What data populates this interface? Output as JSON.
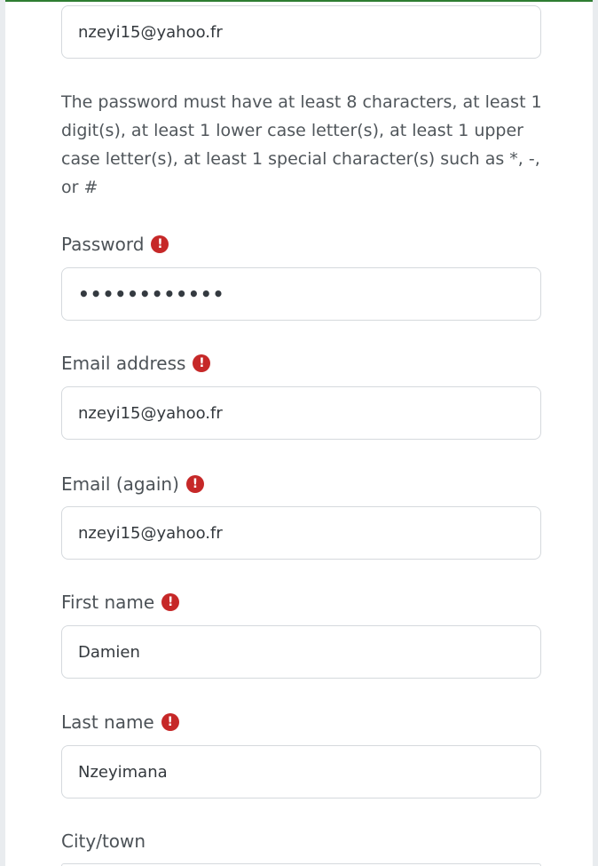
{
  "form": {
    "top_email_value": "nzeyi15@yahoo.fr",
    "password_help": "The password must have at least 8 characters, at least 1 digit(s), at least 1 lower case letter(s), at least 1 upper case letter(s), at least 1 special character(s) such as *, -, or #",
    "password": {
      "label": "Password",
      "value": "••••••••••••"
    },
    "email": {
      "label": "Email address",
      "value": "nzeyi15@yahoo.fr"
    },
    "email_again": {
      "label": "Email (again)",
      "value": "nzeyi15@yahoo.fr"
    },
    "first_name": {
      "label": "First name",
      "value": "Damien"
    },
    "last_name": {
      "label": "Last name",
      "value": "Nzeyimana"
    },
    "city": {
      "label": "City/town"
    },
    "required_icon_glyph": "!"
  },
  "colors": {
    "required_icon": "#c62828",
    "top_border": "#2e7d32"
  }
}
